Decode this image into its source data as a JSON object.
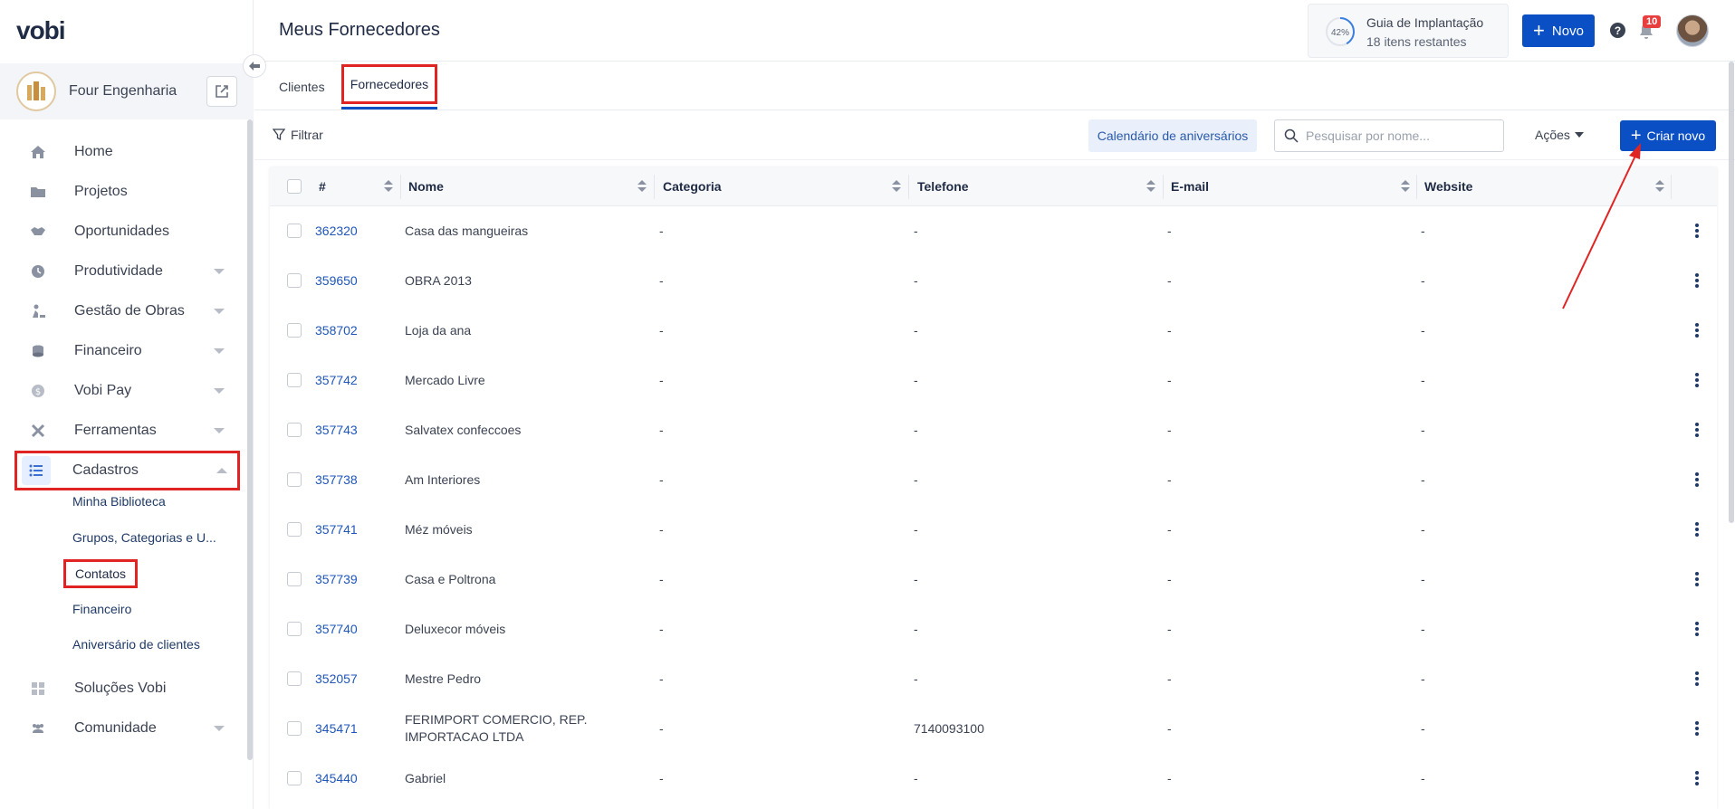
{
  "brand": {
    "logo_text": "vobi"
  },
  "company": {
    "name": "Four Engenharia"
  },
  "sidebar": {
    "items": [
      {
        "label": "Home",
        "icon": "home-icon"
      },
      {
        "label": "Projetos",
        "icon": "folder-icon"
      },
      {
        "label": "Oportunidades",
        "icon": "handshake-icon"
      },
      {
        "label": "Produtividade",
        "icon": "clock-icon"
      },
      {
        "label": "Gestão de Obras",
        "icon": "worker-icon"
      },
      {
        "label": "Financeiro",
        "icon": "coins-icon"
      },
      {
        "label": "Vobi Pay",
        "icon": "dollar-icon"
      },
      {
        "label": "Ferramentas",
        "icon": "tools-icon"
      },
      {
        "label": "Cadastros",
        "icon": "list-icon"
      },
      {
        "label": "Soluções Vobi",
        "icon": "grid-icon"
      },
      {
        "label": "Comunidade",
        "icon": "people-icon"
      }
    ],
    "cadastros_sub": [
      "Minha Biblioteca",
      "Grupos, Categorias e U...",
      "Contatos",
      "Financeiro",
      "Aniversário de clientes"
    ]
  },
  "header": {
    "title": "Meus Fornecedores",
    "guide": {
      "percent": "42%",
      "title": "Guia de Implantação",
      "subtitle": "18 itens restantes"
    },
    "novo_label": "Novo",
    "help": "?",
    "notifications": "10"
  },
  "tabs": [
    {
      "label": "Clientes"
    },
    {
      "label": "Fornecedores"
    }
  ],
  "toolbar": {
    "filter_label": "Filtrar",
    "birthday_label": "Calendário de aniversários",
    "search_placeholder": "Pesquisar por nome...",
    "actions_label": "Ações",
    "create_label": "Criar novo"
  },
  "table": {
    "columns": [
      "#",
      "Nome",
      "Categoria",
      "Telefone",
      "E-mail",
      "Website"
    ],
    "rows": [
      {
        "id": "362320",
        "nome": "Casa das mangueiras",
        "nome2": "",
        "categoria": "-",
        "telefone": "-",
        "email": "-",
        "website": "-"
      },
      {
        "id": "359650",
        "nome": "OBRA 2013",
        "nome2": "",
        "categoria": "-",
        "telefone": "-",
        "email": "-",
        "website": "-"
      },
      {
        "id": "358702",
        "nome": "Loja da ana",
        "nome2": "",
        "categoria": "-",
        "telefone": "-",
        "email": "-",
        "website": "-"
      },
      {
        "id": "357742",
        "nome": "Mercado Livre",
        "nome2": "",
        "categoria": "-",
        "telefone": "-",
        "email": "-",
        "website": "-"
      },
      {
        "id": "357743",
        "nome": "Salvatex confeccoes",
        "nome2": "",
        "categoria": "-",
        "telefone": "-",
        "email": "-",
        "website": "-"
      },
      {
        "id": "357738",
        "nome": "Am Interiores",
        "nome2": "",
        "categoria": "-",
        "telefone": "-",
        "email": "-",
        "website": "-"
      },
      {
        "id": "357741",
        "nome": "Méz móveis",
        "nome2": "",
        "categoria": "-",
        "telefone": "-",
        "email": "-",
        "website": "-"
      },
      {
        "id": "357739",
        "nome": "Casa e Poltrona",
        "nome2": "",
        "categoria": "-",
        "telefone": "-",
        "email": "-",
        "website": "-"
      },
      {
        "id": "357740",
        "nome": "Deluxecor móveis",
        "nome2": "",
        "categoria": "-",
        "telefone": "-",
        "email": "-",
        "website": "-"
      },
      {
        "id": "352057",
        "nome": "Mestre Pedro",
        "nome2": "",
        "categoria": "-",
        "telefone": "-",
        "email": "-",
        "website": "-"
      },
      {
        "id": "345471",
        "nome": "FERIMPORT COMERCIO, REP.",
        "nome2": "IMPORTACAO LTDA",
        "categoria": "-",
        "telefone": "7140093100",
        "email": "-",
        "website": "-"
      },
      {
        "id": "345440",
        "nome": "Gabriel",
        "nome2": "",
        "categoria": "-",
        "telefone": "-",
        "email": "-",
        "website": "-"
      }
    ]
  },
  "colors": {
    "primary": "#0b4fc4",
    "highlight": "#e02424",
    "link": "#1f56b8"
  }
}
